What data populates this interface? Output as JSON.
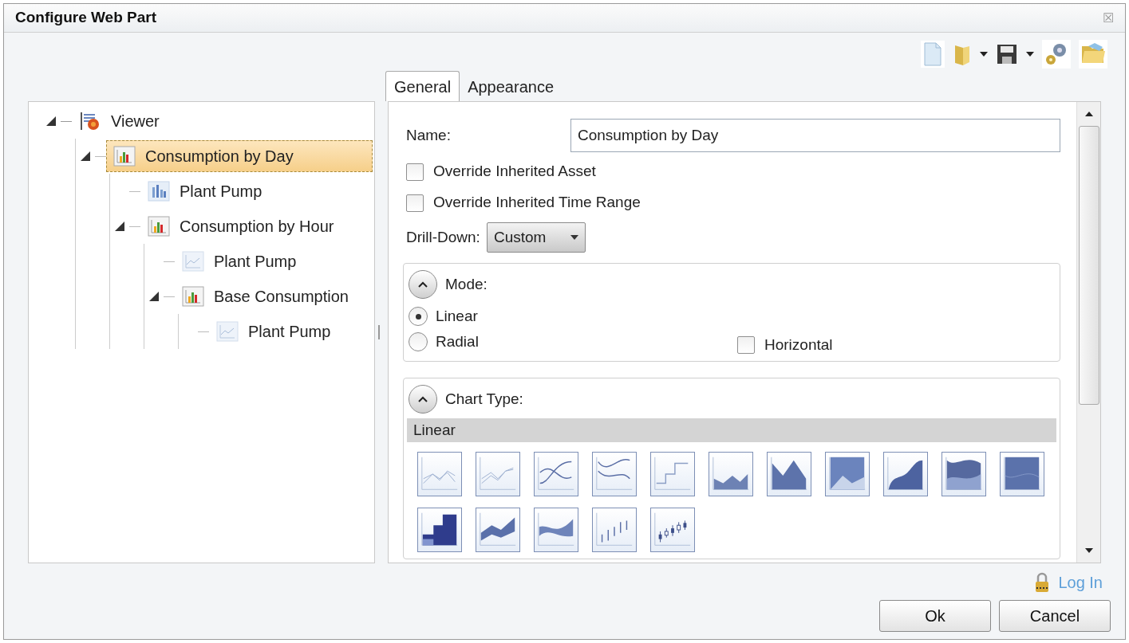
{
  "window": {
    "title": "Configure Web Part",
    "close": "☒"
  },
  "toolbar": [
    {
      "kind": "new"
    },
    {
      "kind": "folder",
      "dropdown": true
    },
    {
      "kind": "save",
      "dropdown": true
    },
    {
      "kind": "gears"
    },
    {
      "kind": "open"
    }
  ],
  "tabs": [
    {
      "label": "General",
      "selected": true
    },
    {
      "label": "Appearance",
      "selected": false
    }
  ],
  "tree": [
    {
      "label": "Viewer",
      "kind": "viewer",
      "expanded": true,
      "selected": false,
      "children": [
        {
          "label": "Consumption by Day",
          "kind": "bar",
          "expanded": true,
          "selected": true,
          "children": [
            {
              "label": "Plant Pump",
              "kind": "column",
              "selected": false
            },
            {
              "label": "Consumption by Hour",
              "kind": "bar",
              "expanded": true,
              "selected": false,
              "children": [
                {
                  "label": "Plant Pump",
                  "kind": "line",
                  "selected": false
                },
                {
                  "label": "Base Consumption",
                  "kind": "bar",
                  "expanded": true,
                  "selected": false,
                  "children": [
                    {
                      "label": "Plant Pump",
                      "kind": "line",
                      "selected": false
                    }
                  ]
                }
              ]
            }
          ]
        }
      ]
    }
  ],
  "form": {
    "name_label": "Name:",
    "name_value": "Consumption by Day",
    "checkboxes": [
      {
        "label": "Override Inherited Asset",
        "checked": false
      },
      {
        "label": "Override Inherited Time Range",
        "checked": false
      }
    ],
    "drilldown_label": "Drill-Down:",
    "drilldown_value": "Custom"
  },
  "mode": {
    "title": "Mode:",
    "expanded": true,
    "options": [
      {
        "label": "Linear",
        "selected": true
      },
      {
        "label": "Radial",
        "selected": false
      }
    ],
    "horizontal": {
      "label": "Horizontal",
      "checked": false
    }
  },
  "chart_type": {
    "title": "Chart Type:",
    "expanded": true,
    "group": "Linear",
    "types": [
      {
        "kind": "line"
      },
      {
        "kind": "line-dual"
      },
      {
        "kind": "spline"
      },
      {
        "kind": "spline-dual"
      },
      {
        "kind": "step"
      },
      {
        "kind": "area"
      },
      {
        "kind": "area-dark"
      },
      {
        "kind": "area-full"
      },
      {
        "kind": "spline-area"
      },
      {
        "kind": "spline-area-full"
      },
      {
        "kind": "range-full"
      },
      {
        "kind": "step-area"
      },
      {
        "kind": "range"
      },
      {
        "kind": "spline-range"
      },
      {
        "kind": "error-bar"
      },
      {
        "kind": "candlestick"
      }
    ]
  },
  "login": "Log In",
  "buttons": [
    "Ok",
    "Cancel"
  ]
}
